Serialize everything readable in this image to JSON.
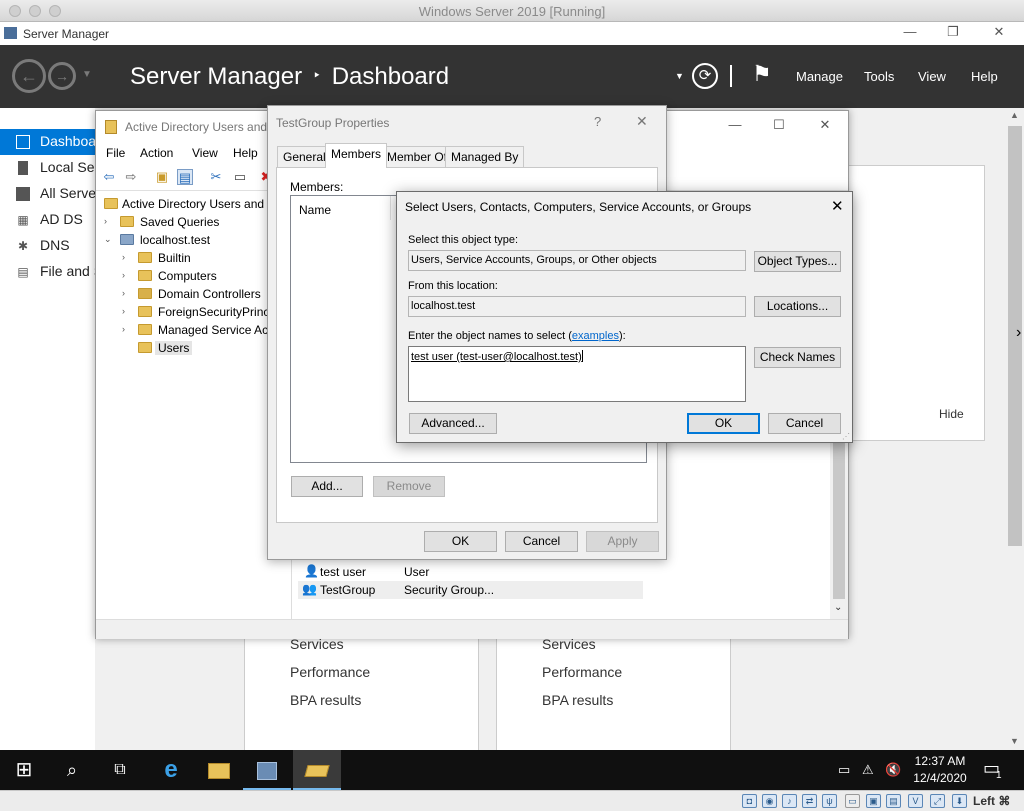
{
  "host": {
    "title": "Windows Server 2019 [Running]"
  },
  "server_manager": {
    "title": "Server Manager",
    "breadcrumb": {
      "app": "Server Manager",
      "separator": "‣",
      "page": "Dashboard"
    },
    "menu": [
      "Manage",
      "Tools",
      "View",
      "Help"
    ],
    "sidebar": [
      {
        "label": "Dashboard",
        "icon": "dashboard-icon",
        "selected": true
      },
      {
        "label": "Local Server",
        "icon": "server-icon"
      },
      {
        "label": "All Servers",
        "icon": "servers-icon"
      },
      {
        "label": "AD DS",
        "icon": "ad-ds-icon"
      },
      {
        "label": "DNS",
        "icon": "dns-icon"
      },
      {
        "label": "File and Storage Services",
        "icon": "file-storage-icon"
      }
    ],
    "hide_label": "Hide",
    "tile_left": {
      "links": [
        "Services",
        "Performance",
        "BPA results"
      ]
    },
    "tile_right": {
      "links": [
        "Services",
        "Performance",
        "BPA results"
      ]
    }
  },
  "aduc": {
    "title": "Active Directory Users and Computers",
    "menu": [
      "File",
      "Action",
      "View",
      "Help"
    ],
    "tree": {
      "root": "Active Directory Users and Computers",
      "saved_queries": "Saved Queries",
      "domain": "localhost.test",
      "children": [
        "Builtin",
        "Computers",
        "Domain Controllers",
        "ForeignSecurityPrincipals",
        "Managed Service Accounts",
        "Users"
      ]
    },
    "list": [
      {
        "name": "test user",
        "type": "User"
      },
      {
        "name": "TestGroup",
        "type": "Security Group..."
      }
    ]
  },
  "properties": {
    "title": "TestGroup Properties",
    "help": "?",
    "tabs": [
      "General",
      "Members",
      "Member Of",
      "Managed By"
    ],
    "members_label": "Members:",
    "column_name": "Name",
    "add": "Add...",
    "remove": "Remove",
    "ok": "OK",
    "cancel": "Cancel",
    "apply": "Apply"
  },
  "select_dialog": {
    "title": "Select Users, Contacts, Computers, Service Accounts, or Groups",
    "object_type_label": "Select this object type:",
    "object_type_value": "Users, Service Accounts, Groups, or Other objects",
    "object_types_btn": "Object Types...",
    "location_label": "From this location:",
    "location_value": "localhost.test",
    "locations_btn": "Locations...",
    "names_label_pre": "Enter the object names to select (",
    "names_label_link": "examples",
    "names_label_post": "):",
    "names_value": "test user (test-user@localhost.test)",
    "check_names_btn": "Check Names",
    "advanced_btn": "Advanced...",
    "ok_btn": "OK",
    "cancel_btn": "Cancel"
  },
  "taskbar": {
    "time": "12:37 AM",
    "date": "12/4/2020",
    "notifications": "1"
  },
  "vbox": {
    "host_key": "Left ⌘"
  }
}
